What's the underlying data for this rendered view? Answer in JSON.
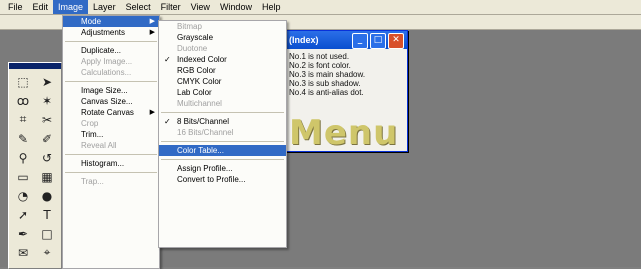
{
  "menubar": {
    "items": [
      "File",
      "Edit",
      "Image",
      "Layer",
      "Select",
      "Filter",
      "View",
      "Window",
      "Help"
    ],
    "active_index": 2
  },
  "document": {
    "title": "(Index)",
    "lines": [
      "No.1 is not used.",
      "No.2 is font color.",
      "No.3 is main shadow.",
      "No.3 is sub shadow.",
      "No.4 is anti-alias dot."
    ],
    "canvas_text": "Menu",
    "buttons": [
      "minimize",
      "maximize",
      "close"
    ]
  },
  "image_menu": {
    "items": [
      {
        "label": "Mode",
        "submenu": true,
        "highlighted": true
      },
      {
        "label": "Adjustments",
        "submenu": true
      },
      {
        "sep": true
      },
      {
        "label": "Duplicate..."
      },
      {
        "label": "Apply Image...",
        "disabled": true
      },
      {
        "label": "Calculations...",
        "disabled": true
      },
      {
        "sep": true
      },
      {
        "label": "Image Size..."
      },
      {
        "label": "Canvas Size..."
      },
      {
        "label": "Rotate Canvas",
        "submenu": true
      },
      {
        "label": "Crop",
        "disabled": true
      },
      {
        "label": "Trim..."
      },
      {
        "label": "Reveal All",
        "disabled": true
      },
      {
        "sep": true
      },
      {
        "label": "Histogram..."
      },
      {
        "sep": true
      },
      {
        "label": "Trap...",
        "disabled": true
      }
    ]
  },
  "mode_menu": {
    "items": [
      {
        "label": "Bitmap",
        "disabled": true
      },
      {
        "label": "Grayscale"
      },
      {
        "label": "Duotone",
        "disabled": true
      },
      {
        "label": "Indexed Color",
        "checked": true
      },
      {
        "label": "RGB Color"
      },
      {
        "label": "CMYK Color"
      },
      {
        "label": "Lab Color"
      },
      {
        "label": "Multichannel",
        "disabled": true
      },
      {
        "sep": true
      },
      {
        "label": "8 Bits/Channel",
        "checked": true
      },
      {
        "label": "16 Bits/Channel",
        "disabled": true
      },
      {
        "sep": true
      },
      {
        "label": "Color Table...",
        "highlighted": true
      },
      {
        "sep": true
      },
      {
        "label": "Assign Profile..."
      },
      {
        "label": "Convert to Profile..."
      }
    ]
  },
  "toolbox": {
    "tools": [
      "marquee-tool",
      "move-tool",
      "lasso-tool",
      "magic-wand-tool",
      "crop-tool",
      "slice-tool",
      "brush-tool",
      "pencil-tool",
      "clone-stamp-tool",
      "history-brush-tool",
      "eraser-tool",
      "gradient-tool",
      "blur-tool",
      "dodge-tool",
      "path-select-tool",
      "type-tool",
      "pen-tool",
      "shape-tool",
      "notes-tool",
      "eyedropper-tool"
    ],
    "glyphs": [
      "⬚",
      "➤",
      "ꝏ",
      "✶",
      "⌗",
      "✂",
      "✎",
      "✐",
      "⚲",
      "↺",
      "▭",
      "▦",
      "◔",
      "●",
      "➚",
      "T",
      "✒",
      "□",
      "✉",
      "⌖"
    ]
  }
}
